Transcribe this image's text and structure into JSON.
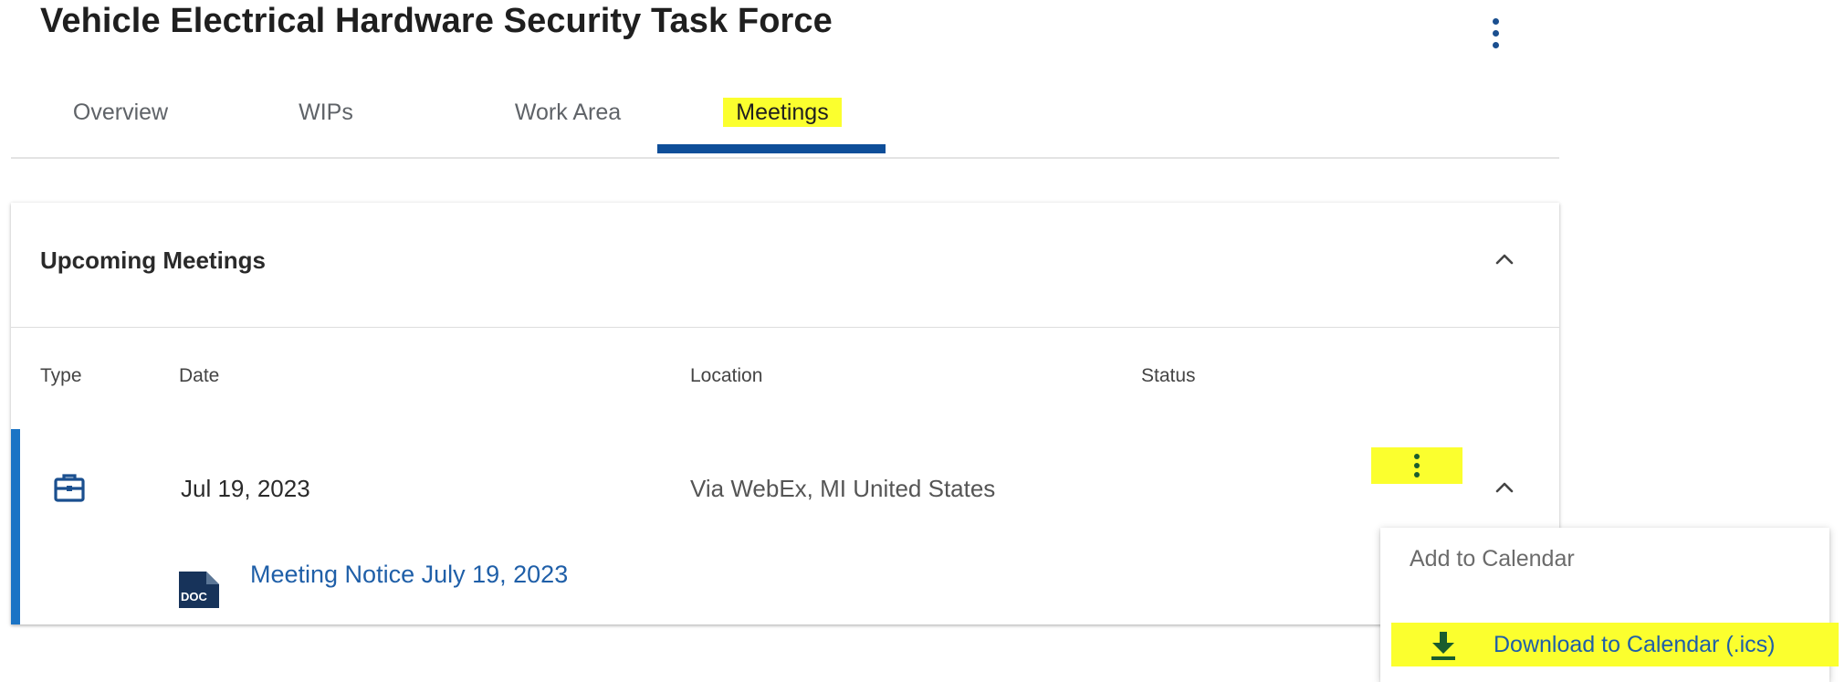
{
  "page": {
    "title": "Vehicle Electrical Hardware Security Task Force",
    "more_icon": "kebab-vertical-icon"
  },
  "tabs": [
    {
      "label": "Overview",
      "active": false
    },
    {
      "label": "WIPs",
      "active": false
    },
    {
      "label": "Work Area",
      "active": false
    },
    {
      "label": "Meetings",
      "active": true
    }
  ],
  "upcoming": {
    "title": "Upcoming Meetings",
    "collapse_icon": "chevron-up-icon",
    "columns": {
      "type": "Type",
      "date": "Date",
      "location": "Location",
      "status": "Status"
    },
    "meetings": [
      {
        "type_icon": "briefcase-icon",
        "date": "Jul 19, 2023",
        "location": "Via WebEx, MI United States",
        "status": "",
        "document": {
          "icon": "doc-file-icon",
          "icon_text": "DOC",
          "label": "Meeting Notice July 19, 2023"
        }
      }
    ]
  },
  "context_menu": {
    "title": "Add to Calendar",
    "items": [
      {
        "label": "Download to Calendar (.ics)",
        "icon": "download-icon"
      }
    ]
  },
  "colors": {
    "accent": "#0e4e99",
    "highlight": "#fbff2e",
    "link": "#1f5fa8",
    "row_accent": "#1b74c5",
    "download_icon": "#1a5d2e"
  }
}
